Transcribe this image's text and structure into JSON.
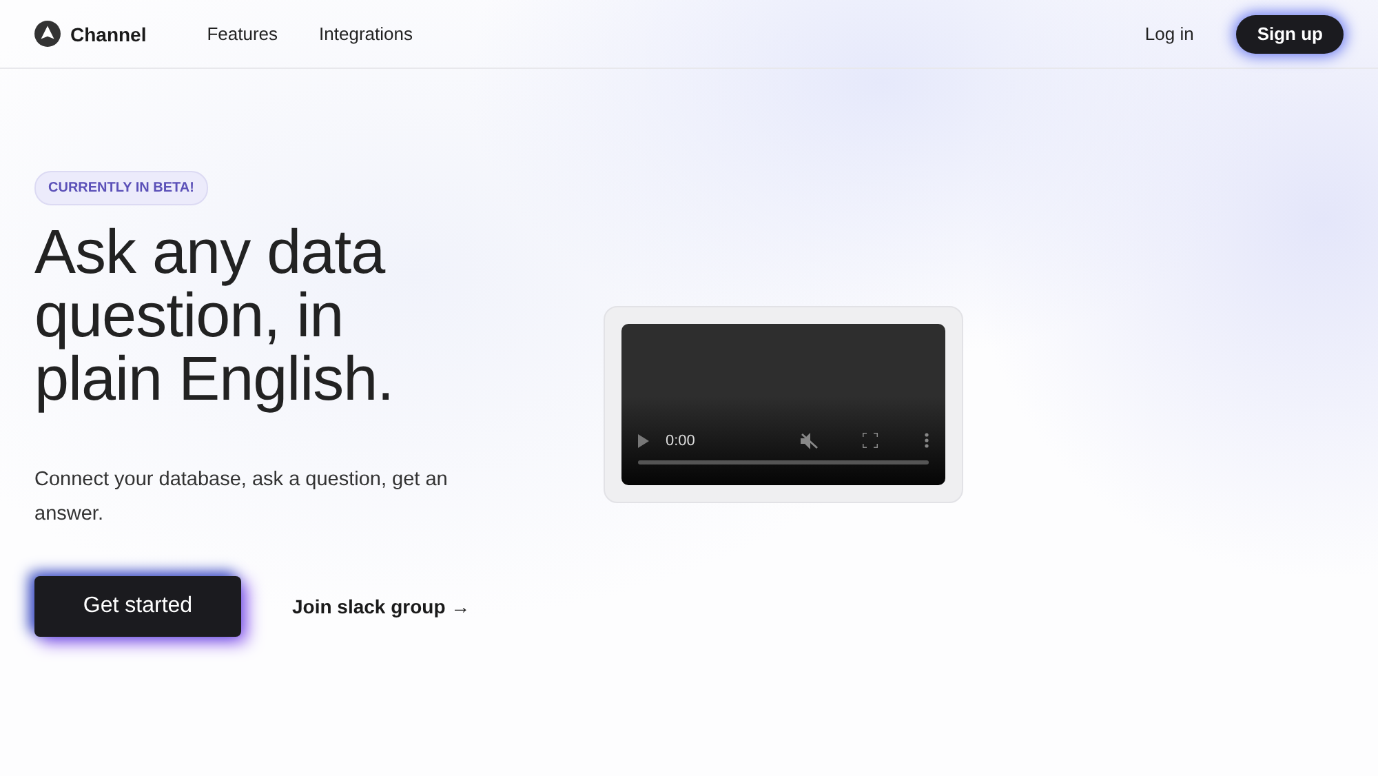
{
  "nav": {
    "brand": "Channel",
    "links": [
      "Features",
      "Integrations"
    ],
    "login": "Log in",
    "signup": "Sign up"
  },
  "hero": {
    "badge": "CURRENTLY IN BETA!",
    "title": [
      "Ask any data",
      "question, in",
      "plain English."
    ],
    "subtitle": "Connect your database, ask a question, get an answer.",
    "primary": "Get started",
    "secondary": "Join slack group →"
  },
  "video": {
    "time": "0:00",
    "muted": true,
    "level": 0
  }
}
